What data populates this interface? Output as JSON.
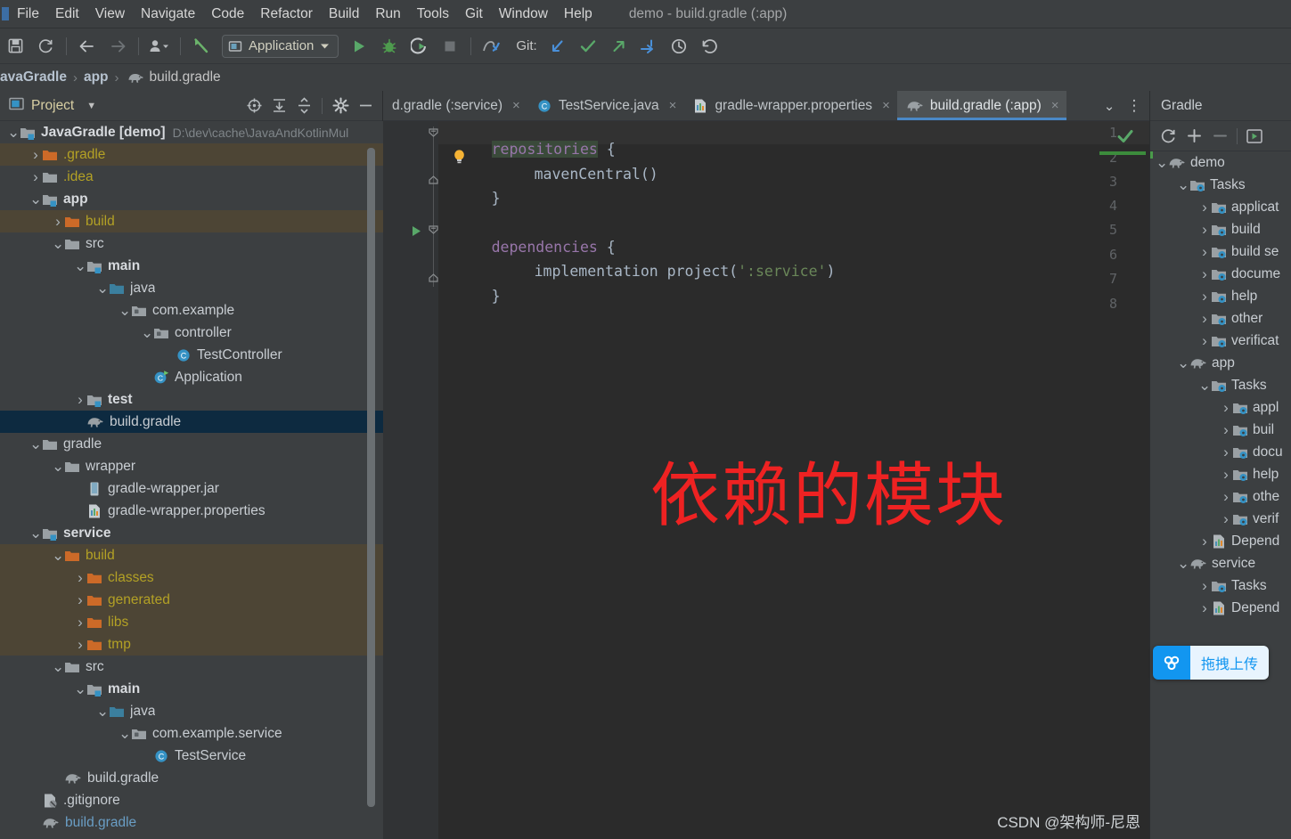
{
  "window": {
    "title": "demo - build.gradle (:app)"
  },
  "menu": {
    "items": [
      {
        "label": "File"
      },
      {
        "label": "Edit"
      },
      {
        "label": "View"
      },
      {
        "label": "Navigate"
      },
      {
        "label": "Code"
      },
      {
        "label": "Refactor"
      },
      {
        "label": "Build"
      },
      {
        "label": "Run"
      },
      {
        "label": "Tools"
      },
      {
        "label": "Git"
      },
      {
        "label": "Window"
      },
      {
        "label": "Help"
      }
    ]
  },
  "toolbar": {
    "icons": [
      "save-icon",
      "sync-icon",
      "back-arrow-icon",
      "forward-arrow-icon",
      "profile-dropdown-icon",
      "update-project-icon"
    ],
    "run_config": "Application",
    "run_icon": "run-icon",
    "debug_icon": "debug-icon",
    "coverage_icon": "run-with-coverage-icon",
    "stop_icon": "stop-icon",
    "profiler_icon": "profiler-icon",
    "git_label": "Git:",
    "git_icons": [
      "git-update-icon",
      "git-commit-icon",
      "git-push-icon",
      "git-rebase-icon",
      "history-icon",
      "rollback-icon"
    ]
  },
  "breadcrumb": {
    "items": [
      {
        "label": "avaGradle",
        "bold": true,
        "icon": ""
      },
      {
        "label": "app",
        "bold": true,
        "icon": ""
      },
      {
        "label": "build.gradle",
        "bold": false,
        "icon": "gradle-elephant-icon"
      }
    ],
    "separator": "›"
  },
  "project_panel": {
    "title": "Project",
    "dropdown_icon": "chevron-down-icon",
    "actions": [
      "locate-target-icon",
      "expand-all-icon",
      "collapse-all-icon",
      "settings-gear-icon",
      "hide-panel-icon"
    ],
    "tree": [
      {
        "depth": 0,
        "arrow": "v",
        "icon": "module-folder-icon",
        "label": "JavaGradle [demo]",
        "style": "bold",
        "hint": "D:\\dev\\cache\\JavaAndKotlinMul"
      },
      {
        "depth": 1,
        "arrow": ">",
        "icon": "excluded-folder-icon",
        "label": ".gradle",
        "style": "orange",
        "bg": "excluded"
      },
      {
        "depth": 1,
        "arrow": ">",
        "icon": "folder-icon",
        "label": ".idea",
        "style": "orange"
      },
      {
        "depth": 1,
        "arrow": "v",
        "icon": "module-folder-icon",
        "label": "app",
        "style": "bold"
      },
      {
        "depth": 2,
        "arrow": ">",
        "icon": "excluded-folder-icon",
        "label": "build",
        "style": "orange",
        "bg": "excluded"
      },
      {
        "depth": 2,
        "arrow": "v",
        "icon": "folder-icon",
        "label": "src",
        "style": ""
      },
      {
        "depth": 3,
        "arrow": "v",
        "icon": "module-folder-icon",
        "label": "main",
        "style": "bold"
      },
      {
        "depth": 4,
        "arrow": "v",
        "icon": "source-folder-icon",
        "label": "java",
        "style": ""
      },
      {
        "depth": 5,
        "arrow": "v",
        "icon": "package-icon",
        "label": "com.example",
        "style": ""
      },
      {
        "depth": 6,
        "arrow": "v",
        "icon": "package-icon",
        "label": "controller",
        "style": ""
      },
      {
        "depth": 7,
        "arrow": "",
        "icon": "java-class-icon",
        "label": "TestController",
        "style": ""
      },
      {
        "depth": 6,
        "arrow": "",
        "icon": "java-class-runnable-icon",
        "label": "Application",
        "style": ""
      },
      {
        "depth": 3,
        "arrow": ">",
        "icon": "module-folder-icon",
        "label": "test",
        "style": "bold"
      },
      {
        "depth": 3,
        "arrow": "",
        "icon": "gradle-elephant-icon",
        "label": "build.gradle",
        "style": "",
        "bg": "selected"
      },
      {
        "depth": 1,
        "arrow": "v",
        "icon": "folder-icon",
        "label": "gradle",
        "style": ""
      },
      {
        "depth": 2,
        "arrow": "v",
        "icon": "folder-icon",
        "label": "wrapper",
        "style": ""
      },
      {
        "depth": 3,
        "arrow": "",
        "icon": "jar-icon",
        "label": "gradle-wrapper.jar",
        "style": ""
      },
      {
        "depth": 3,
        "arrow": "",
        "icon": "properties-icon",
        "label": "gradle-wrapper.properties",
        "style": ""
      },
      {
        "depth": 1,
        "arrow": "v",
        "icon": "module-folder-icon",
        "label": "service",
        "style": "bold"
      },
      {
        "depth": 2,
        "arrow": "v",
        "icon": "excluded-folder-icon",
        "label": "build",
        "style": "orange",
        "bg": "excluded"
      },
      {
        "depth": 3,
        "arrow": ">",
        "icon": "excluded-folder-icon",
        "label": "classes",
        "style": "orange",
        "bg": "excluded"
      },
      {
        "depth": 3,
        "arrow": ">",
        "icon": "excluded-folder-icon",
        "label": "generated",
        "style": "orange",
        "bg": "excluded"
      },
      {
        "depth": 3,
        "arrow": ">",
        "icon": "excluded-folder-icon",
        "label": "libs",
        "style": "orange",
        "bg": "excluded"
      },
      {
        "depth": 3,
        "arrow": ">",
        "icon": "excluded-folder-icon",
        "label": "tmp",
        "style": "orange",
        "bg": "excluded"
      },
      {
        "depth": 2,
        "arrow": "v",
        "icon": "folder-icon",
        "label": "src",
        "style": ""
      },
      {
        "depth": 3,
        "arrow": "v",
        "icon": "module-folder-icon",
        "label": "main",
        "style": "bold"
      },
      {
        "depth": 4,
        "arrow": "v",
        "icon": "source-folder-icon",
        "label": "java",
        "style": ""
      },
      {
        "depth": 5,
        "arrow": "v",
        "icon": "package-icon",
        "label": "com.example.service",
        "style": ""
      },
      {
        "depth": 6,
        "arrow": "",
        "icon": "java-class-icon",
        "label": "TestService",
        "style": ""
      },
      {
        "depth": 2,
        "arrow": "",
        "icon": "gradle-elephant-icon",
        "label": "build.gradle",
        "style": ""
      },
      {
        "depth": 1,
        "arrow": "",
        "icon": "gitignore-icon",
        "label": ".gitignore",
        "style": ""
      },
      {
        "depth": 1,
        "arrow": "",
        "icon": "gradle-elephant-icon",
        "label": "build.gradle",
        "style": "blue"
      }
    ]
  },
  "editor": {
    "tabs": [
      {
        "label": "d.gradle (:service)",
        "icon": "",
        "active": false,
        "close": "×"
      },
      {
        "label": "TestService.java",
        "icon": "java-class-icon",
        "active": false,
        "close": "×"
      },
      {
        "label": "gradle-wrapper.properties",
        "icon": "properties-icon",
        "active": false,
        "close": "×"
      },
      {
        "label": "build.gradle (:app)",
        "icon": "gradle-elephant-icon",
        "active": true,
        "close": "×"
      }
    ],
    "tab_actions": [
      "chevron-down-icon",
      "more-options-icon"
    ],
    "line_numbers": [
      "1",
      "2",
      "3",
      "4",
      "5",
      "6",
      "7",
      "8"
    ],
    "code": {
      "l1_kw": "repositories",
      "l1_brace": " {",
      "l2": "mavenCentral()",
      "l3": "}",
      "l5_kw": "dependencies",
      "l5_brace": " {",
      "l6_kw": "implementation",
      "l6_fn": " project(",
      "l6_str": "':service'",
      "l6_end": ")",
      "l7": "}"
    },
    "gutter_icons": [
      "intention-bulb-icon",
      "run-gradle-task-icon"
    ],
    "inspection_status": "inspections-ok-icon",
    "annotation": "依赖的模块",
    "watermark": "CSDN @架构师-尼恩"
  },
  "gradle_panel": {
    "title": "Gradle",
    "actions": [
      "refresh-icon",
      "add-icon",
      "remove-icon",
      "execute-task-icon"
    ],
    "tree": [
      {
        "depth": 0,
        "arrow": "v",
        "icon": "gradle-elephant-icon",
        "label": "demo"
      },
      {
        "depth": 1,
        "arrow": "v",
        "icon": "tasks-folder-icon",
        "label": "Tasks"
      },
      {
        "depth": 2,
        "arrow": ">",
        "icon": "tasks-folder-icon",
        "label": "applicat"
      },
      {
        "depth": 2,
        "arrow": ">",
        "icon": "tasks-folder-icon",
        "label": "build"
      },
      {
        "depth": 2,
        "arrow": ">",
        "icon": "tasks-folder-icon",
        "label": "build se"
      },
      {
        "depth": 2,
        "arrow": ">",
        "icon": "tasks-folder-icon",
        "label": "docume"
      },
      {
        "depth": 2,
        "arrow": ">",
        "icon": "tasks-folder-icon",
        "label": "help"
      },
      {
        "depth": 2,
        "arrow": ">",
        "icon": "tasks-folder-icon",
        "label": "other"
      },
      {
        "depth": 2,
        "arrow": ">",
        "icon": "tasks-folder-icon",
        "label": "verificat"
      },
      {
        "depth": 1,
        "arrow": "v",
        "icon": "gradle-elephant-icon",
        "label": "app"
      },
      {
        "depth": 2,
        "arrow": "v",
        "icon": "tasks-folder-icon",
        "label": "Tasks"
      },
      {
        "depth": 3,
        "arrow": ">",
        "icon": "tasks-folder-icon",
        "label": "appl"
      },
      {
        "depth": 3,
        "arrow": ">",
        "icon": "tasks-folder-icon",
        "label": "buil"
      },
      {
        "depth": 3,
        "arrow": ">",
        "icon": "tasks-folder-icon",
        "label": "docu"
      },
      {
        "depth": 3,
        "arrow": ">",
        "icon": "tasks-folder-icon",
        "label": "help"
      },
      {
        "depth": 3,
        "arrow": ">",
        "icon": "tasks-folder-icon",
        "label": "othe"
      },
      {
        "depth": 3,
        "arrow": ">",
        "icon": "tasks-folder-icon",
        "label": "verif"
      },
      {
        "depth": 2,
        "arrow": ">",
        "icon": "dependencies-icon",
        "label": "Depend"
      },
      {
        "depth": 1,
        "arrow": "v",
        "icon": "gradle-elephant-icon",
        "label": "service"
      },
      {
        "depth": 2,
        "arrow": ">",
        "icon": "tasks-folder-icon",
        "label": "Tasks"
      },
      {
        "depth": 2,
        "arrow": ">",
        "icon": "dependencies-icon",
        "label": "Depend"
      }
    ]
  },
  "float_widget": {
    "icon": "cloud-upload-icon",
    "label": "拖拽上传"
  },
  "colors": {
    "panel_bg": "#3c3f41",
    "editor_bg": "#2b2b2b",
    "selection": "#0d2a40",
    "excluded_row": "#4d4535",
    "accent_blue": "#4a88c7",
    "annotation_red": "#ee2222",
    "orange_folder": "#cc6a28",
    "excluded_text": "#b3a125",
    "widget_blue": "#1296f0"
  }
}
